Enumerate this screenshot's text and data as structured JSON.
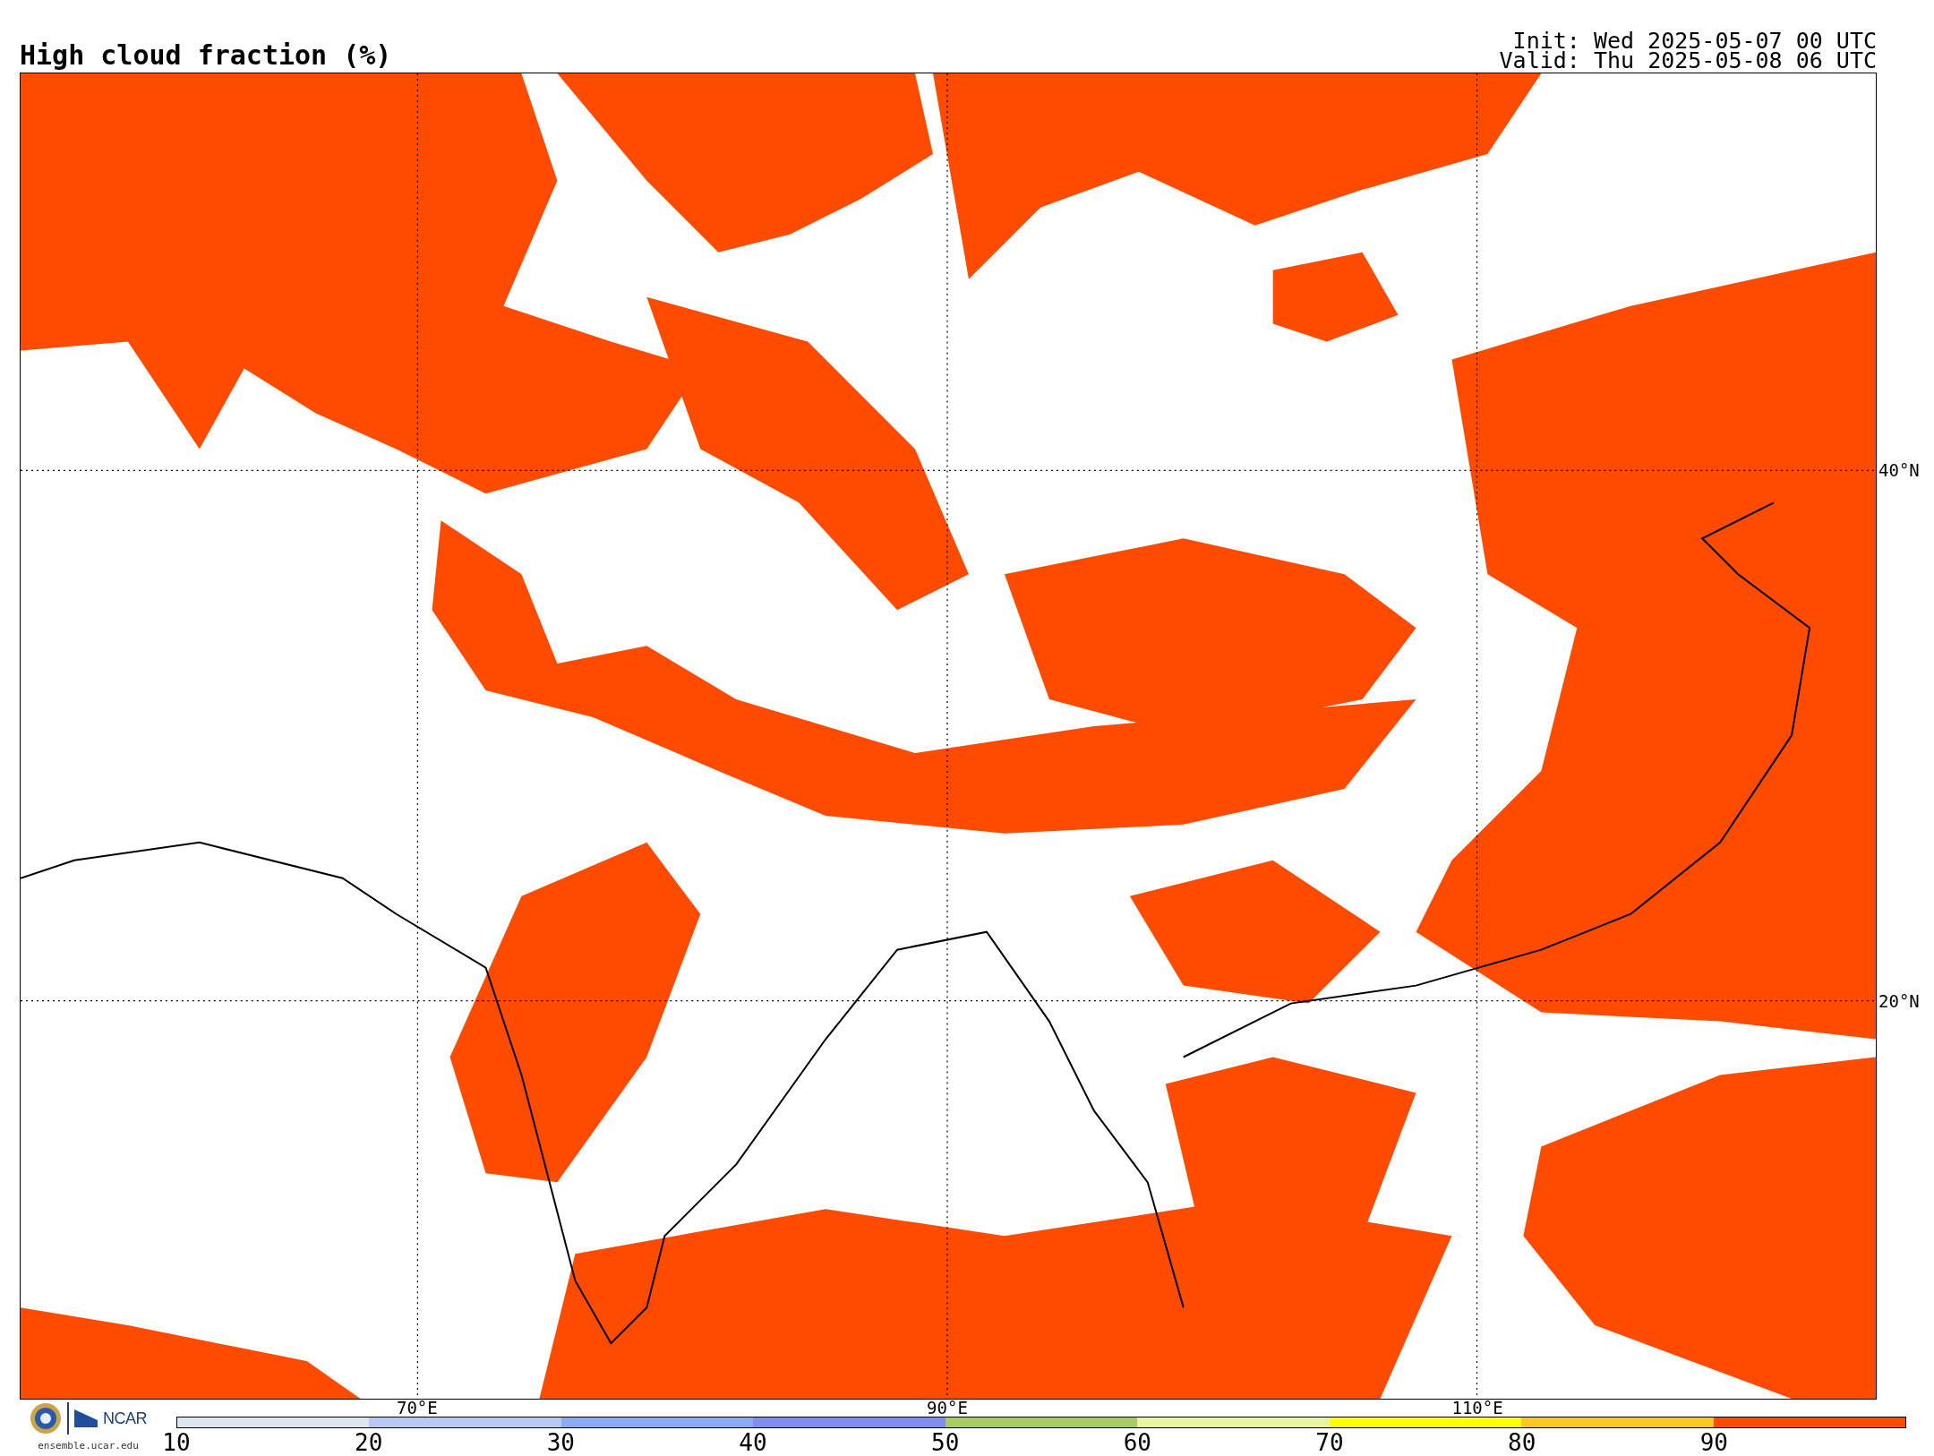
{
  "title": "High cloud fraction (%)",
  "init": "Init: Wed 2025-05-07 00 UTC",
  "valid": "Valid: Thu 2025-05-08 06 UTC",
  "map": {
    "lon_labels": [
      "70°E",
      "90°E",
      "110°E"
    ],
    "lat_labels": [
      "40°N",
      "20°N"
    ]
  },
  "logo": {
    "name": "NCAR",
    "url": "ensemble.ucar.edu"
  },
  "colorbar": {
    "segments": [
      {
        "color": "#dde6ee"
      },
      {
        "color": "#b8c9f6"
      },
      {
        "color": "#8eaaf5"
      },
      {
        "color": "#7f8ef0"
      },
      {
        "color": "#a6cc62"
      },
      {
        "color": "#e8f5a0"
      },
      {
        "color": "#ffff00"
      },
      {
        "color": "#ffc81e"
      },
      {
        "color": "#ff4b00"
      }
    ],
    "ticks": [
      "10",
      "20",
      "30",
      "40",
      "50",
      "60",
      "70",
      "80",
      "90"
    ]
  }
}
